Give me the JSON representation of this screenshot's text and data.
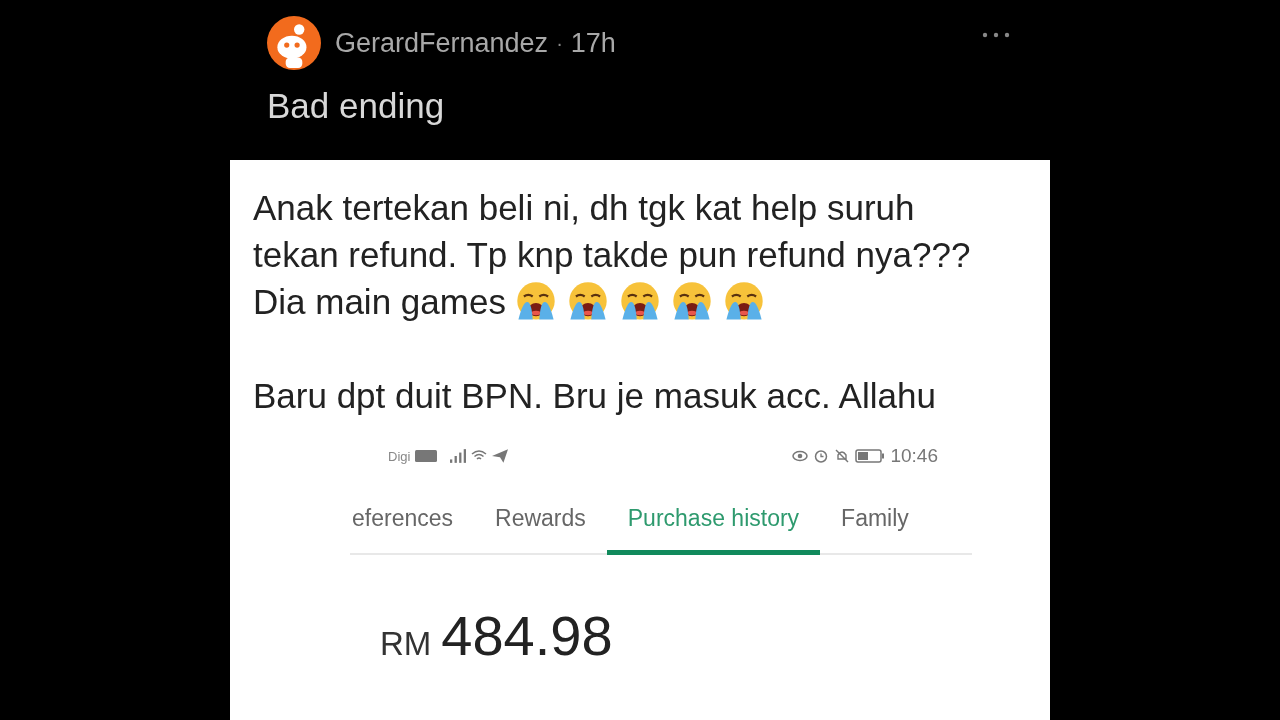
{
  "post": {
    "author": "GerardFernandez",
    "separator": "·",
    "age": "17h",
    "title": "Bad ending"
  },
  "screenshot": {
    "lines": [
      {
        "text": "Anak tertekan beli ni, dh tgk kat help suruh"
      },
      {
        "text": "tekan refund. Tp knp takde pun refund nya???"
      },
      {
        "text": "Dia main games",
        "icons": [
          {
            "kind": "crying"
          },
          {
            "kind": "crying"
          },
          {
            "kind": "crying"
          },
          {
            "kind": "crying"
          },
          {
            "kind": "crying"
          }
        ]
      },
      {
        "text": "Baru dpt duit BPN. Bru je masuk acc. Allahu",
        "paragraph_break": true
      }
    ],
    "phone": {
      "carrier": "Digi",
      "time": "10:46",
      "tabs": [
        {
          "label": "eferences",
          "selected": false
        },
        {
          "label": "Rewards",
          "selected": false
        },
        {
          "label": "Purchase history",
          "selected": true
        },
        {
          "label": "Family",
          "selected": false
        }
      ],
      "currency": "RM",
      "amount": "484.98"
    }
  }
}
